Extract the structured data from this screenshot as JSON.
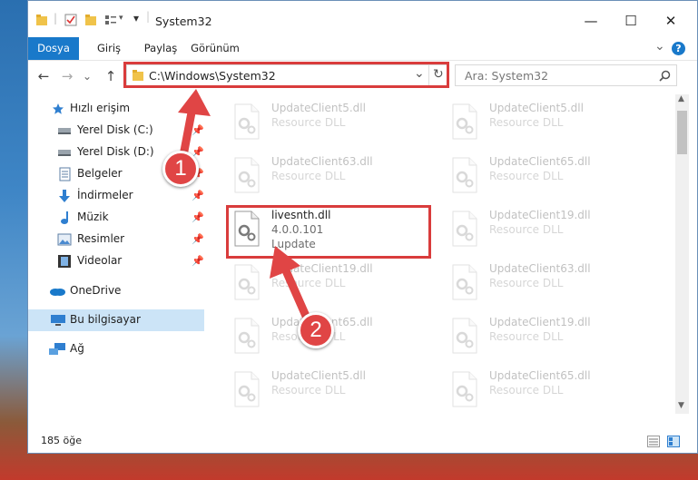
{
  "window": {
    "title": "System32",
    "minimize_glyph": "—",
    "maximize_glyph": "☐",
    "close_glyph": "✕"
  },
  "ribbon": {
    "tabs": [
      {
        "label": "Dosya",
        "active": true
      },
      {
        "label": "Giriş"
      },
      {
        "label": "Paylaş"
      },
      {
        "label": "Görünüm"
      }
    ],
    "expand_glyph": "⌄",
    "help_glyph": "?"
  },
  "address": {
    "path": "C:\\Windows\\System32",
    "dropdown_glyph": "⌄",
    "refresh_glyph": "↻"
  },
  "nav": {
    "back_glyph": "←",
    "forward_glyph": "→",
    "recent_glyph": "⌄",
    "up_glyph": "↑"
  },
  "search": {
    "placeholder": "Ara: System32",
    "icon": "search-icon"
  },
  "sidebar": {
    "items": [
      {
        "label": "Hızlı erişim",
        "icon": "star-icon"
      },
      {
        "label": "Yerel Disk (C:)",
        "icon": "drive-icon",
        "pinned": true
      },
      {
        "label": "Yerel Disk (D:)",
        "icon": "drive-icon",
        "pinned": true
      },
      {
        "label": "Belgeler",
        "icon": "document-icon",
        "pinned": true
      },
      {
        "label": "İndirmeler",
        "icon": "download-icon",
        "pinned": true
      },
      {
        "label": "Müzik",
        "icon": "music-icon",
        "pinned": true
      },
      {
        "label": "Resimler",
        "icon": "picture-icon",
        "pinned": true
      },
      {
        "label": "Videolar",
        "icon": "video-icon",
        "pinned": true
      },
      {
        "label": "OneDrive",
        "icon": "cloud-icon"
      },
      {
        "label": "Bu bilgisayar",
        "icon": "computer-icon",
        "selected": true
      },
      {
        "label": "Ağ",
        "icon": "network-icon"
      }
    ]
  },
  "files": {
    "left": [
      {
        "name": "UpdateClient5.dll",
        "desc": "Resource DLL"
      },
      {
        "name": "UpdateClient63.dll",
        "desc": "Resource DLL"
      },
      {
        "name": "livesnth.dll",
        "desc": "4.0.0.101",
        "sub": "Lupdate",
        "highlighted": true
      },
      {
        "name": "UpdateClient19.dll",
        "desc": "Resource DLL"
      },
      {
        "name": "UpdateClient65.dll",
        "desc": "Resource DLL"
      },
      {
        "name": "UpdateClient5.dll",
        "desc": "Resource DLL"
      }
    ],
    "right": [
      {
        "name": "UpdateClient5.dll",
        "desc": "Resource DLL"
      },
      {
        "name": "UpdateClient65.dll",
        "desc": "Resource DLL"
      },
      {
        "name": "UpdateClient19.dll",
        "desc": "Resource DLL"
      },
      {
        "name": "UpdateClient63.dll",
        "desc": "Resource DLL"
      },
      {
        "name": "UpdateClient19.dll",
        "desc": "Resource DLL"
      },
      {
        "name": "UpdateClient65.dll",
        "desc": "Resource DLL"
      }
    ]
  },
  "status": {
    "count": "185 öğe"
  },
  "annotations": {
    "badge1": "1",
    "badge2": "2",
    "color": "#d93c3c"
  }
}
